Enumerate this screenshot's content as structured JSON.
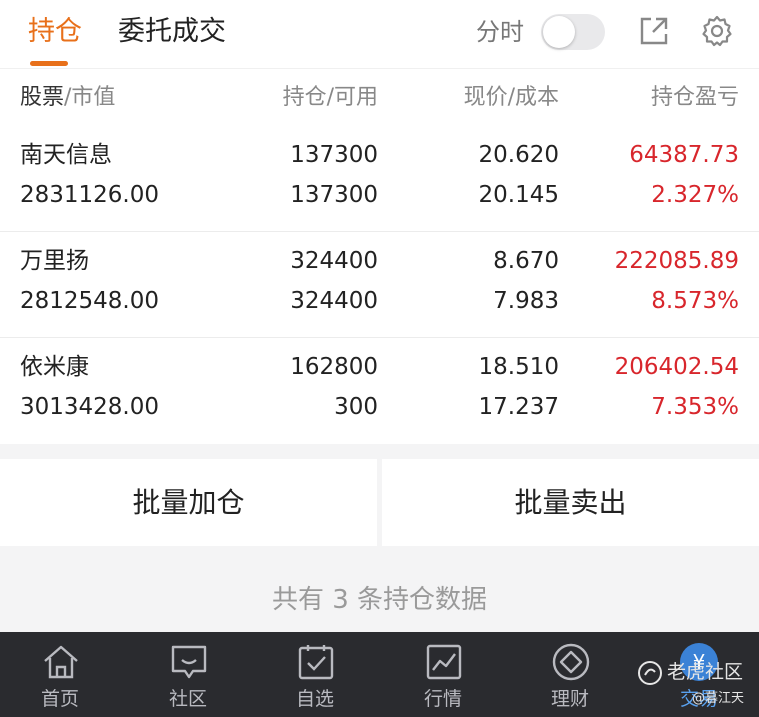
{
  "tabs": {
    "holdings": "持仓",
    "orders": "委托成交"
  },
  "toolbar": {
    "fenshi_label": "分时",
    "share_icon": "share-out-icon",
    "settings_icon": "gear-icon"
  },
  "columns": {
    "stock": "股票",
    "market_value": "/市值",
    "position": "持仓/可用",
    "price": "现价/成本",
    "pnl": "持仓盈亏"
  },
  "rows": [
    {
      "name": "南天信息",
      "market_value": "2831126.00",
      "position": "137300",
      "available": "137300",
      "price": "20.620",
      "cost": "20.145",
      "pnl": "64387.73",
      "pnl_pct": "2.327%"
    },
    {
      "name": "万里扬",
      "market_value": "2812548.00",
      "position": "324400",
      "available": "324400",
      "price": "8.670",
      "cost": "7.983",
      "pnl": "222085.89",
      "pnl_pct": "8.573%"
    },
    {
      "name": "依米康",
      "market_value": "3013428.00",
      "position": "162800",
      "available": "300",
      "price": "18.510",
      "cost": "17.237",
      "pnl": "206402.54",
      "pnl_pct": "7.353%"
    }
  ],
  "actions": {
    "batch_add": "批量加仓",
    "batch_sell": "批量卖出"
  },
  "summary": "共有 3 条持仓数据",
  "nav": [
    {
      "label": "首页",
      "icon": "home-icon"
    },
    {
      "label": "社区",
      "icon": "chat-bubble-icon"
    },
    {
      "label": "自选",
      "icon": "watchlist-check-icon"
    },
    {
      "label": "行情",
      "icon": "market-chart-icon"
    },
    {
      "label": "理财",
      "icon": "wealth-diamond-icon"
    }
  ],
  "trade": {
    "badge": "¥",
    "label": "交易"
  },
  "watermark": {
    "main": "老虎社区",
    "sub": "@暮江天"
  },
  "colors": {
    "accent": "#e8701a",
    "profit": "#d8262c",
    "nav_bg": "#2a2b2f",
    "trade_blue": "#3b82d6"
  }
}
